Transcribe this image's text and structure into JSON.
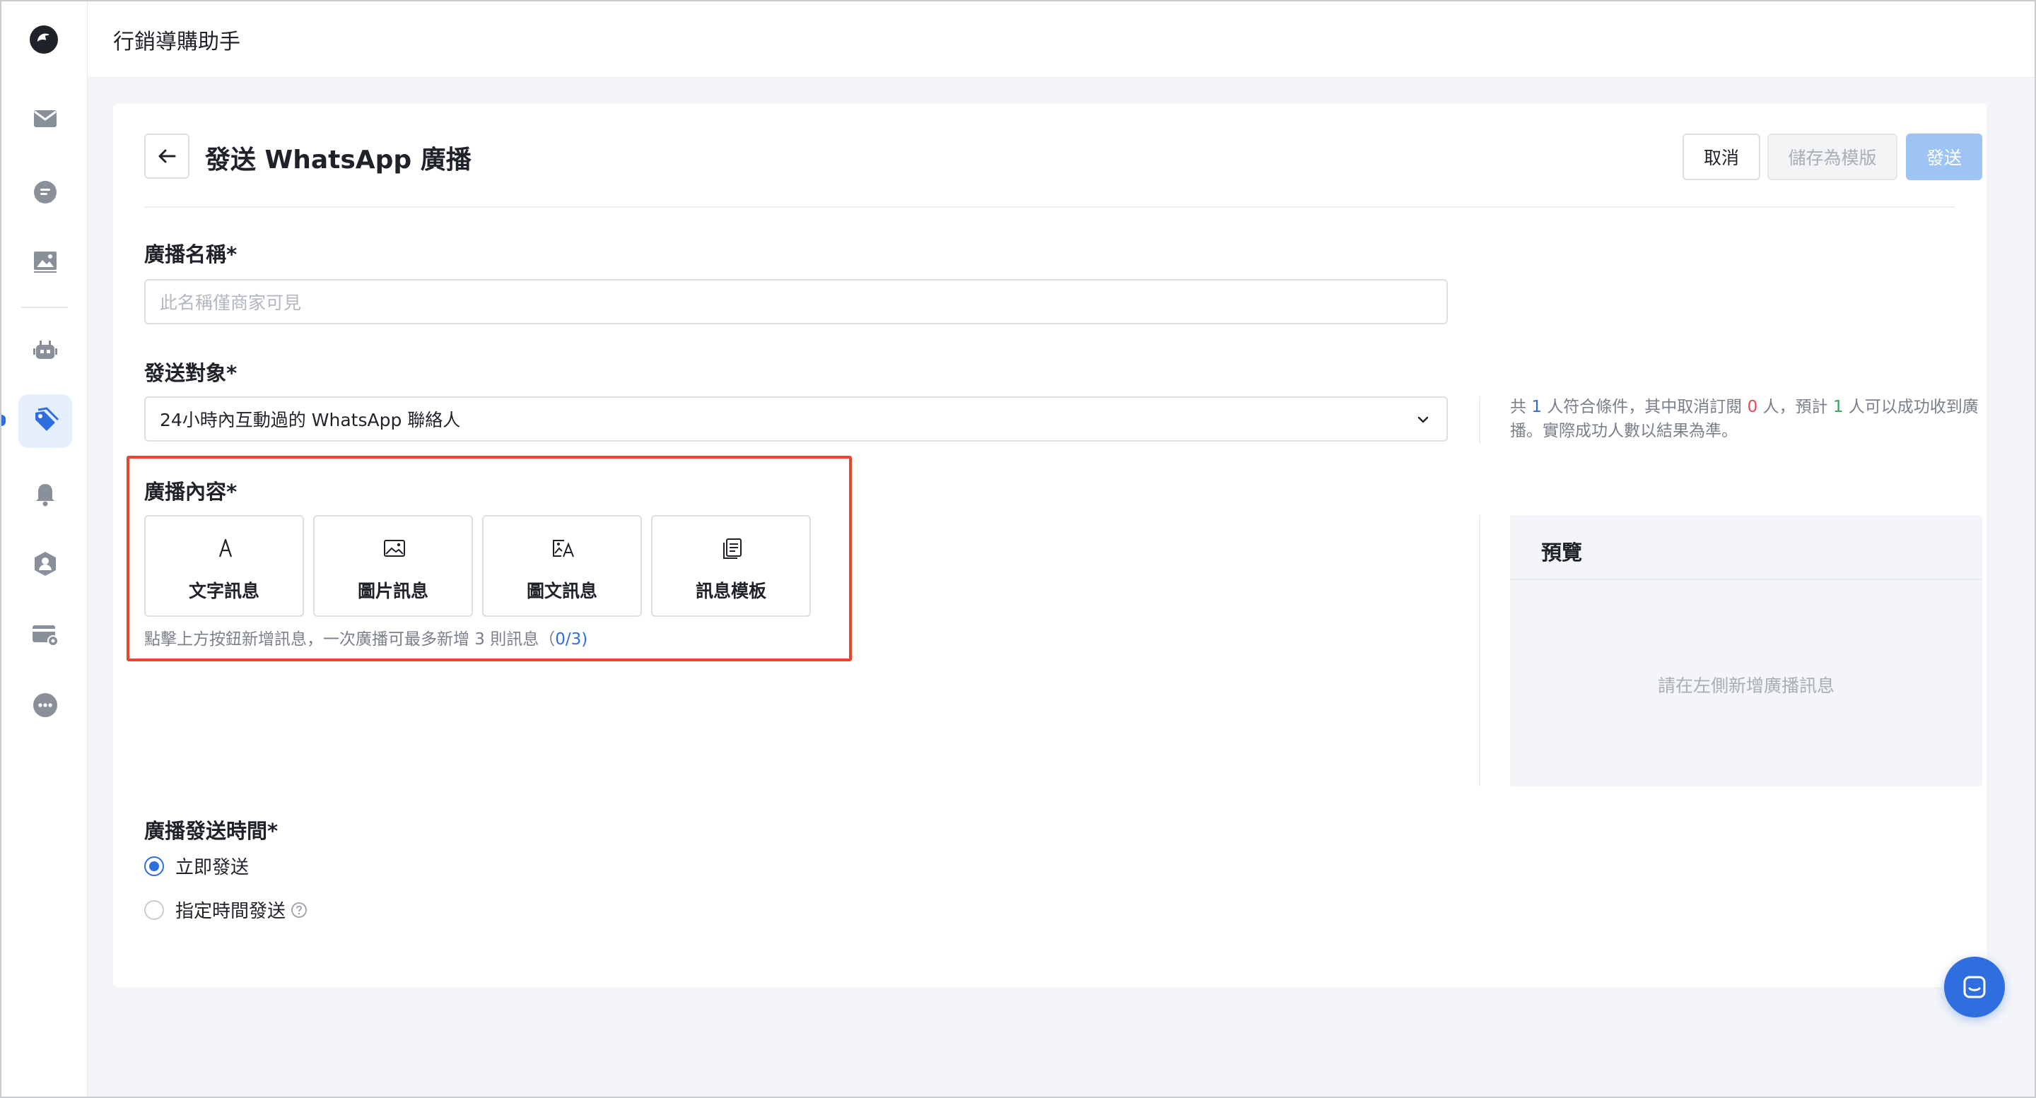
{
  "app": {
    "title": "行銷導購助手"
  },
  "sidebar": {
    "items": [
      {
        "icon": "mail-icon"
      },
      {
        "icon": "chat-icon"
      },
      {
        "icon": "image-icon"
      },
      {
        "icon": "robot-icon"
      },
      {
        "icon": "tag-icon",
        "active": true
      },
      {
        "icon": "bell-icon"
      },
      {
        "icon": "contact-icon"
      },
      {
        "icon": "card-settings-icon"
      },
      {
        "icon": "more-icon"
      }
    ]
  },
  "header": {
    "title": "發送 WhatsApp 廣播",
    "cancel_label": "取消",
    "save_template_label": "儲存為模版",
    "send_label": "發送"
  },
  "form": {
    "name": {
      "label": "廣播名稱*",
      "placeholder": "此名稱僅商家可見"
    },
    "audience": {
      "label": "發送對象*",
      "value": "24小時內互動過的 WhatsApp 聯絡人",
      "hint_1": "共",
      "hint_count": "1",
      "hint_2": "人符合條件，其中取消訂閱",
      "hint_unsub": "0",
      "hint_3": "人，預計",
      "hint_expected": "1",
      "hint_4": "人可以成功收到廣播。實際成功人數以結果為準。"
    },
    "content": {
      "label": "廣播內容*",
      "tiles": [
        {
          "label": "文字訊息",
          "icon": "text-icon"
        },
        {
          "label": "圖片訊息",
          "icon": "image-icon"
        },
        {
          "label": "圖文訊息",
          "icon": "image-text-icon"
        },
        {
          "label": "訊息模板",
          "icon": "template-icon"
        }
      ],
      "note_prefix": "點擊上方按鈕新增訊息，一次廣播可最多新增 3 則訊息（",
      "note_count": "0",
      "note_suffix": "/3)"
    },
    "schedule": {
      "label": "廣播發送時間*",
      "options": [
        {
          "label": "立即發送",
          "checked": true
        },
        {
          "label": "指定時間發送",
          "checked": false
        }
      ]
    }
  },
  "preview": {
    "title": "預覽",
    "empty_text": "請在左側新增廣播訊息"
  },
  "colors": {
    "primary": "#2f6ede",
    "highlight": "#e8462e",
    "danger": "#e5484d",
    "success": "#2fa84f"
  }
}
